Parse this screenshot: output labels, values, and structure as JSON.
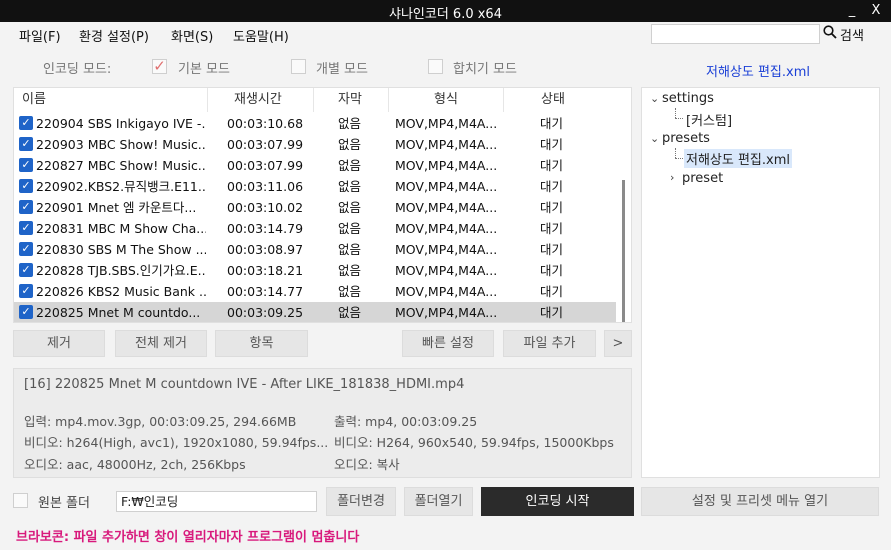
{
  "window": {
    "title": "샤나인코더  6.0 x64",
    "minimize": "_",
    "close": "X"
  },
  "menu": {
    "items": [
      "파일(F)",
      "환경 설정(P)",
      "화면(S)",
      "도움말(H)"
    ],
    "search_label": "검색",
    "search_value": ""
  },
  "mode": {
    "label": "인코딩 모드:",
    "options": [
      "기본 모드",
      "개별 모드",
      "합치기 모드"
    ],
    "selected": 0,
    "preset_file": "저해상도 편집.xml"
  },
  "file_list": {
    "columns": [
      "이름",
      "재생시간",
      "자막",
      "형식",
      "상태"
    ],
    "rows": [
      {
        "name": "220904 SBS Inkigayo IVE -...",
        "duration": "00:03:10.68",
        "subtitle": "없음",
        "format": "MOV,MP4,M4A...",
        "status": "대기",
        "checked": true
      },
      {
        "name": "220903 MBC Show! Music...",
        "duration": "00:03:07.99",
        "subtitle": "없음",
        "format": "MOV,MP4,M4A...",
        "status": "대기",
        "checked": true
      },
      {
        "name": "220827 MBC Show! Music...",
        "duration": "00:03:07.99",
        "subtitle": "없음",
        "format": "MOV,MP4,M4A...",
        "status": "대기",
        "checked": true
      },
      {
        "name": "220902.KBS2.뮤직뱅크.E11...",
        "duration": "00:03:11.06",
        "subtitle": "없음",
        "format": "MOV,MP4,M4A...",
        "status": "대기",
        "checked": true
      },
      {
        "name": "220901 Mnet 엠 카운트다...",
        "duration": "00:03:10.02",
        "subtitle": "없음",
        "format": "MOV,MP4,M4A...",
        "status": "대기",
        "checked": true
      },
      {
        "name": "220831 MBC M Show Cha...",
        "duration": "00:03:14.79",
        "subtitle": "없음",
        "format": "MOV,MP4,M4A...",
        "status": "대기",
        "checked": true
      },
      {
        "name": "220830 SBS M The Show ...",
        "duration": "00:03:08.97",
        "subtitle": "없음",
        "format": "MOV,MP4,M4A...",
        "status": "대기",
        "checked": true
      },
      {
        "name": "220828 TJB.SBS.인기가요.E...",
        "duration": "00:03:18.21",
        "subtitle": "없음",
        "format": "MOV,MP4,M4A...",
        "status": "대기",
        "checked": true
      },
      {
        "name": "220826 KBS2 Music Bank ...",
        "duration": "00:03:14.77",
        "subtitle": "없음",
        "format": "MOV,MP4,M4A...",
        "status": "대기",
        "checked": true
      },
      {
        "name": "220825 Mnet M countdo...",
        "duration": "00:03:09.25",
        "subtitle": "없음",
        "format": "MOV,MP4,M4A...",
        "status": "대기",
        "checked": true,
        "selected": true
      }
    ]
  },
  "list_buttons": {
    "remove": "제거",
    "remove_all": "전체 제거",
    "items": "항목",
    "quick_settings": "빠른 설정",
    "add_file": "파일 추가",
    "more": ">"
  },
  "info": {
    "file_title": "[16] 220825 Mnet M countdown IVE - After LIKE_181838_HDMI.mp4",
    "input": "입력: mp4.mov.3gp, 00:03:09.25, 294.66MB",
    "video_in": "비디오: h264(High, avc1), 1920x1080, 59.94fps...",
    "audio_in": "오디오: aac, 48000Hz, 2ch, 256Kbps",
    "output": "출력: mp4, 00:03:09.25",
    "video_out": "비디오: H264, 960x540, 59.94fps, 15000Kbps",
    "audio_out": "오디오: 복사"
  },
  "tree": {
    "settings": "settings",
    "custom": "[커스텀]",
    "presets": "presets",
    "preset_file": "저해상도 편집.xml",
    "preset": "preset"
  },
  "bottom": {
    "source_folder_label": "원본 폴더",
    "path": "F:₩인코딩",
    "change_folder": "폴더변경",
    "open_folder": "폴더열기",
    "start_encoding": "인코딩 시작",
    "settings_menu": "설정 및 프리셋 메뉴 열기"
  },
  "notice": "브라보콘: 파일 추가하면 창이 열리자마자 프로그램이 멈춥니다",
  "colors": {
    "accent_blue": "#1f64c8",
    "link_blue": "#1a3fd6",
    "notice_pink": "#d8197c",
    "titlebar": "#111111",
    "encode_button": "#2b2b2b"
  }
}
